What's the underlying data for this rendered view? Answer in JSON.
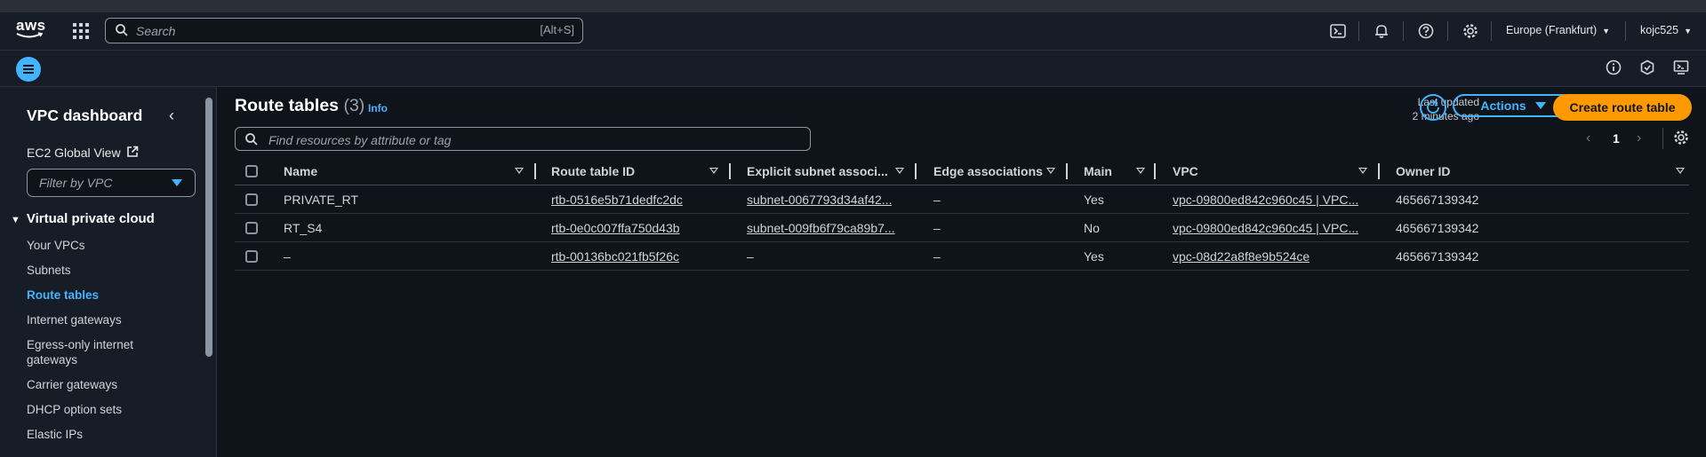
{
  "header": {
    "logo_text": "aws",
    "search_placeholder": "Search",
    "search_shortcut": "[Alt+S]",
    "region": "Europe (Frankfurt)",
    "user": "kojc525"
  },
  "sidebar": {
    "title": "VPC dashboard",
    "ec2_global_view": "EC2 Global View",
    "filter_placeholder": "Filter by VPC",
    "section_title": "Virtual private cloud",
    "items": [
      {
        "label": "Your VPCs",
        "active": false
      },
      {
        "label": "Subnets",
        "active": false
      },
      {
        "label": "Route tables",
        "active": true
      },
      {
        "label": "Internet gateways",
        "active": false
      },
      {
        "label": "Egress-only internet gateways",
        "active": false
      },
      {
        "label": "Carrier gateways",
        "active": false
      },
      {
        "label": "DHCP option sets",
        "active": false
      },
      {
        "label": "Elastic IPs",
        "active": false
      }
    ]
  },
  "main": {
    "title": "Route tables",
    "count": "(3)",
    "info": "Info",
    "last_updated_label": "Last updated",
    "last_updated_value": "2 minutes ago",
    "actions_label": "Actions",
    "create_label": "Create route table",
    "filter_placeholder": "Find resources by attribute or tag",
    "page": "1"
  },
  "table": {
    "columns": [
      "Name",
      "Route table ID",
      "Explicit subnet associ...",
      "Edge associations",
      "Main",
      "VPC",
      "Owner ID"
    ],
    "rows": [
      {
        "name": "PRIVATE_RT",
        "id": "rtb-0516e5b71dedfc2dc",
        "subnet": "subnet-0067793d34af42...",
        "edge": "–",
        "main": "Yes",
        "vpc": "vpc-09800ed842c960c45 | VPC...",
        "owner": "465667139342"
      },
      {
        "name": "RT_S4",
        "id": "rtb-0e0c007ffa750d43b",
        "subnet": "subnet-009fb6f79ca89b7...",
        "edge": "–",
        "main": "No",
        "vpc": "vpc-09800ed842c960c45 | VPC...",
        "owner": "465667139342"
      },
      {
        "name": "–",
        "id": "rtb-00136bc021fb5f26c",
        "subnet": "–",
        "edge": "–",
        "main": "Yes",
        "vpc": "vpc-08d22a8f8e9b524ce",
        "owner": "465667139342"
      }
    ]
  },
  "colors": {
    "accent": "#42b4ff",
    "primary_button": "#ff9900",
    "background": "#0f141a",
    "panel": "#161d26"
  }
}
